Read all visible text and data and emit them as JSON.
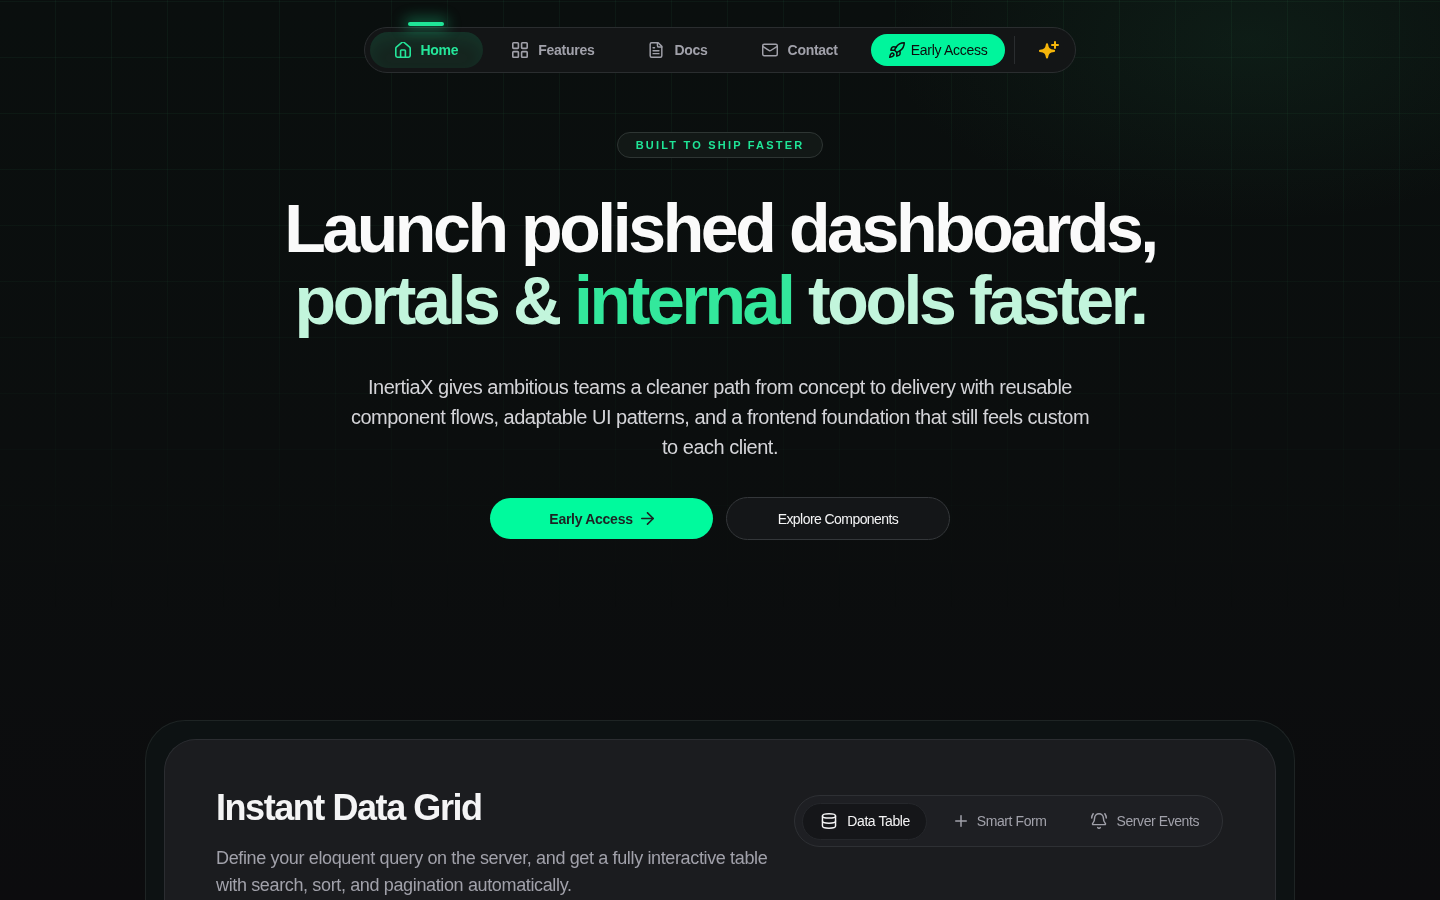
{
  "nav": {
    "items": [
      {
        "label": "Home",
        "selected": true
      },
      {
        "label": "Features",
        "selected": false
      },
      {
        "label": "Docs",
        "selected": false
      },
      {
        "label": "Contact",
        "selected": false
      }
    ],
    "cta": "Early Access"
  },
  "hero": {
    "badge": "BUILT TO SHIP FASTER",
    "heading": {
      "line_1": "Launch polished dashboards,",
      "line_2": [
        {
          "text": "portals & ",
          "highlight": false
        },
        {
          "text": "internal",
          "highlight": true
        },
        {
          "text": " tools faster.",
          "highlight": false
        }
      ]
    },
    "description": "InertiaX gives ambitious teams a cleaner path from concept to delivery with reusable component flows, adaptable UI patterns, and a frontend foundation that still feels custom to each client.",
    "primary_button": "Early Access",
    "secondary_button": "Explore Components"
  },
  "feature": {
    "title": "Instant Data Grid",
    "description": "Define your eloquent query on the server, and get a fully interactive table with search, sort, and pagination automatically.",
    "tabs": [
      {
        "label": "Data Table",
        "selected": true
      },
      {
        "label": "Smart Form",
        "selected": false
      },
      {
        "label": "Server Events",
        "selected": false
      }
    ]
  }
}
